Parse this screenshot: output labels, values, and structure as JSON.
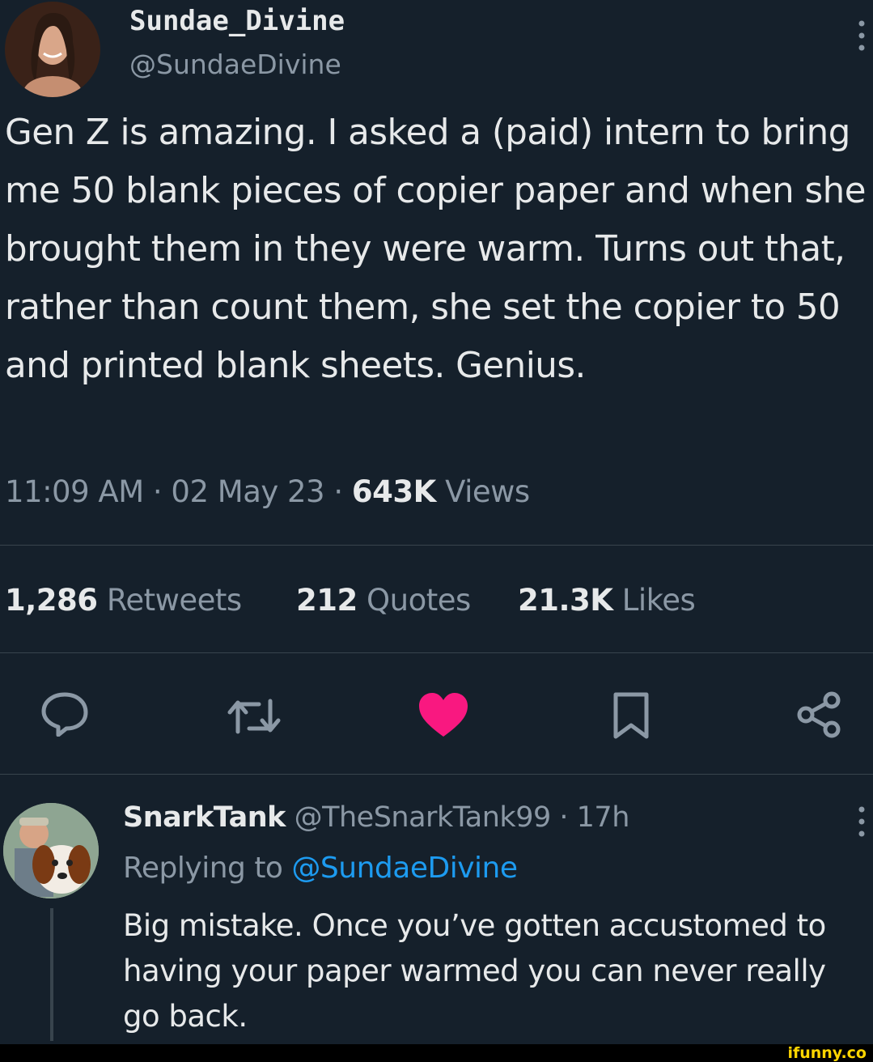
{
  "tweet": {
    "display_name": "Sundae_Divine",
    "handle": "@SundaeDivine",
    "text": "Gen Z is amazing. I asked a (paid) intern to bring me 50 blank pieces of copier paper and when she brought them in they were warm. Turns out that, rather than count them, she set the copier to 50 and printed blank sheets. Genius.",
    "time": "11:09 AM",
    "date": "02 May 23",
    "separator": "·",
    "views_count": "643K",
    "views_label": "Views"
  },
  "stats": {
    "retweets_count": "1,286",
    "retweets_label": "Retweets",
    "quotes_count": "212",
    "quotes_label": "Quotes",
    "likes_count": "21.3K",
    "likes_label": "Likes"
  },
  "actions": {
    "icons": [
      "reply-icon",
      "retweet-icon",
      "like-icon",
      "bookmark-icon",
      "share-icon"
    ],
    "liked_color": "#f91880"
  },
  "reply": {
    "display_name": "SnarkTank",
    "handle": "@TheSnarkTank99",
    "separator": "·",
    "age": "17h",
    "replying_label": "Replying to",
    "replying_handle": "@SundaeDivine",
    "text": "Big mistake. Once you’ve gotten accustomed to having your paper warmed you can never really go back."
  },
  "watermark": "ifunny.co",
  "colors": {
    "background": "#15202b",
    "text": "#e7e9ea",
    "muted": "#8b98a5",
    "link": "#1d9bf0",
    "divider": "#38444d",
    "watermark": "#ffd500"
  }
}
